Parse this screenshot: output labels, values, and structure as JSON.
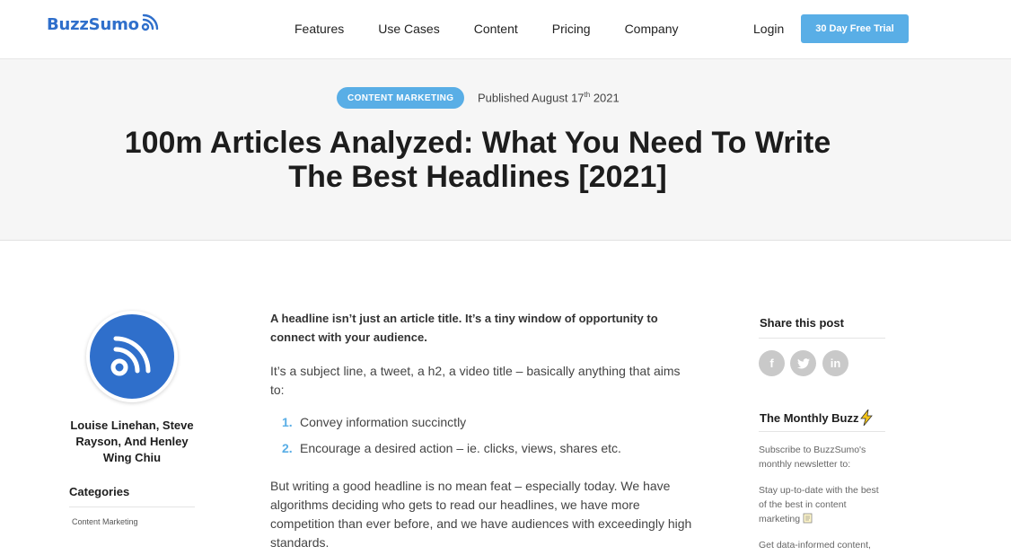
{
  "header": {
    "logo_text": "BuzzSumo",
    "nav": [
      "Features",
      "Use Cases",
      "Content",
      "Pricing",
      "Company"
    ],
    "login": "Login",
    "trial_button": "30 Day Free Trial"
  },
  "hero": {
    "badge": "CONTENT MARKETING",
    "published_prefix": "Published August 17",
    "published_suffix": "th",
    "published_year": " 2021",
    "title": "100m Articles Analyzed: What You Need To Write The Best Headlines [2021]"
  },
  "author": {
    "names": "Louise Linehan, Steve Rayson, And Henley Wing Chiu"
  },
  "categories": {
    "title": "Categories",
    "items": [
      "Content Marketing"
    ]
  },
  "article": {
    "lead": "A headline isn’t just an article title. It’s a tiny window of opportunity to connect with your audience.",
    "para1": "It’s a subject line, a tweet, a h2, a video title – basically anything that aims to:",
    "list": [
      {
        "num": "1.",
        "text": "Convey information succinctly"
      },
      {
        "num": "2.",
        "text": "Encourage a desired action – ie. clicks, views, shares etc."
      }
    ],
    "para2": "But writing a good headline is no mean feat – especially today. We have algorithms deciding who gets to read our headlines, we have more competition than ever before, and we have audiences with exceedingly high standards."
  },
  "sidebar": {
    "share_title": "Share this post",
    "social": [
      {
        "icon": "facebook-icon",
        "glyph": "f"
      },
      {
        "icon": "twitter-icon",
        "glyph": "t"
      },
      {
        "icon": "linkedin-icon",
        "glyph": "in"
      }
    ],
    "buzz_title": "The Monthly Buzz",
    "buzz_text_1": "Subscribe to BuzzSumo's monthly newsletter to:",
    "buzz_text_2": "Stay up-to-date with the best of the best in content marketing",
    "buzz_text_3": "Get data-informed content,"
  },
  "colors": {
    "brand_blue": "#2f6fcb",
    "accent_blue": "#59aee6",
    "hero_bg": "#f6f6f6",
    "social_grey": "#c9c9c9"
  }
}
